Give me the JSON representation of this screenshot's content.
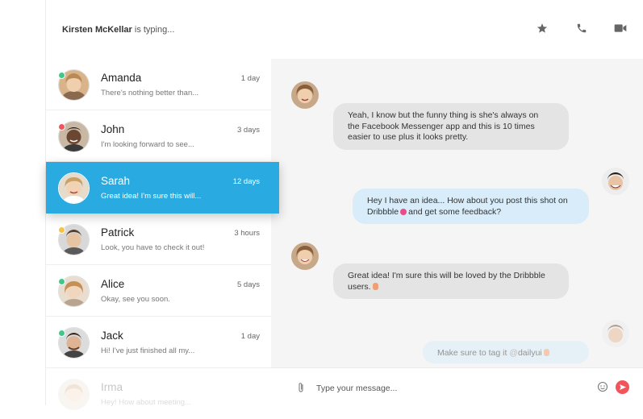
{
  "header": {
    "typing_user": "Kirsten McKellar",
    "typing_suffix": " is typing...",
    "icons": [
      "star-icon",
      "phone-icon",
      "video-icon"
    ]
  },
  "colors": {
    "accent": "#29abe2",
    "online": "#3ec98b",
    "busy": "#f2545b",
    "away": "#f5c242",
    "send": "#f2545b"
  },
  "conversations": [
    {
      "name": "Amanda",
      "preview": "There's nothing better than...",
      "time": "1 day",
      "status": "online"
    },
    {
      "name": "John",
      "preview": "I'm looking forward to see...",
      "time": "3 days",
      "status": "busy"
    },
    {
      "name": "Sarah",
      "preview": "Great idea! I'm sure this will...",
      "time": "12 days",
      "status": "none"
    },
    {
      "name": "Patrick",
      "preview": "Look, you have to check it out!",
      "time": "3 hours",
      "status": "away"
    },
    {
      "name": "Alice",
      "preview": "Okay, see you soon.",
      "time": "5 days",
      "status": "online"
    },
    {
      "name": "Jack",
      "preview": "Hi! I've just finished all my...",
      "time": "1 day",
      "status": "online"
    },
    {
      "name": "Irma",
      "preview": "Hey! How about meeting...",
      "time": "",
      "status": "none"
    }
  ],
  "messages": [
    {
      "direction": "in",
      "line1": "Yeah, I know but the funny thing is she's always on",
      "line2": "the Facebook Messenger app and this is 10 times",
      "line3": "easier to use plus it looks pretty."
    },
    {
      "direction": "out",
      "line1": "Hey I have an idea... How about you post this shot on",
      "line2": "Dribbble",
      "line2_tail": "and get some feedback?"
    },
    {
      "direction": "in",
      "line1": "Great idea! I'm sure this will be loved by the Dribbble",
      "line2": "users."
    },
    {
      "direction": "out",
      "line1": "Make sure to tag it",
      "tag": "dailyui"
    }
  ],
  "composer": {
    "placeholder": "Type your message..."
  }
}
